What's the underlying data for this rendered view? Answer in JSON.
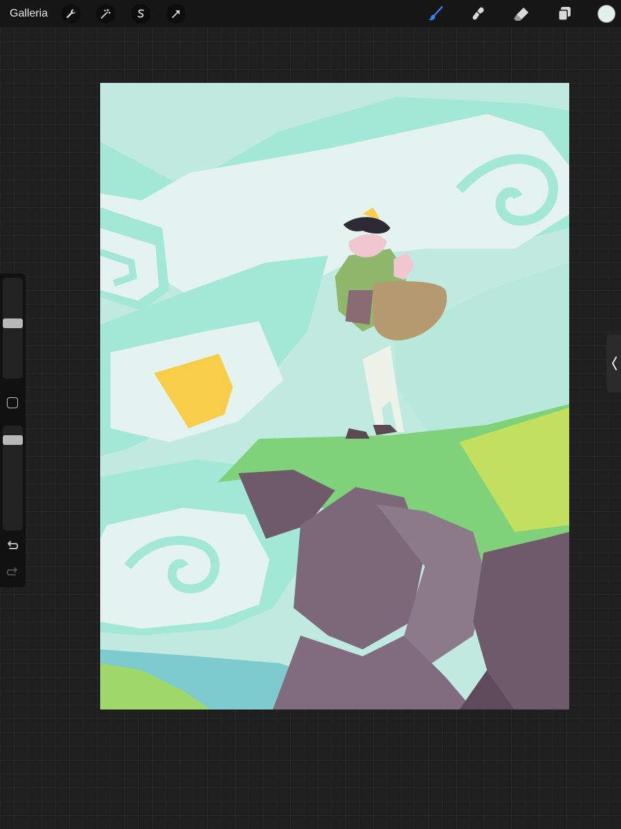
{
  "topbar": {
    "gallery_label": "Galleria",
    "left_tools": [
      {
        "name": "actions",
        "icon": "wrench-icon"
      },
      {
        "name": "adjustments",
        "icon": "magic-wand-icon"
      },
      {
        "name": "selection",
        "icon": "selection-s-icon"
      },
      {
        "name": "transform",
        "icon": "transform-arrow-icon"
      }
    ],
    "right_tools": [
      {
        "name": "brush",
        "icon": "brush-icon",
        "active": true
      },
      {
        "name": "smudge",
        "icon": "smudge-icon",
        "active": false
      },
      {
        "name": "eraser",
        "icon": "eraser-icon",
        "active": false
      },
      {
        "name": "layers",
        "icon": "layers-icon",
        "active": false
      }
    ],
    "current_color": "#e2f2ea",
    "active_tool_color": "#2f86f0"
  },
  "sidebar": {
    "brush_size_level": 0.55,
    "opacity_level": 0.9,
    "undo_icon": "undo-icon",
    "redo_icon": "redo-icon",
    "modify_icon": "square-modify-icon"
  },
  "side_panel": {
    "icon": "chevron-left-icon"
  },
  "artwork": {
    "sky_color": "#c0eadf",
    "cloud_band_color": "#a3e8d6",
    "cloud_white": "#e4f3ef",
    "sun_color": "#f7cd4a",
    "grass_color": "#7fd27a",
    "grass_highlight": "#cfe25a",
    "rock_dark": "#6f5a69",
    "rock_light": "#8b7a88",
    "water_color": "#7ecbcf"
  }
}
